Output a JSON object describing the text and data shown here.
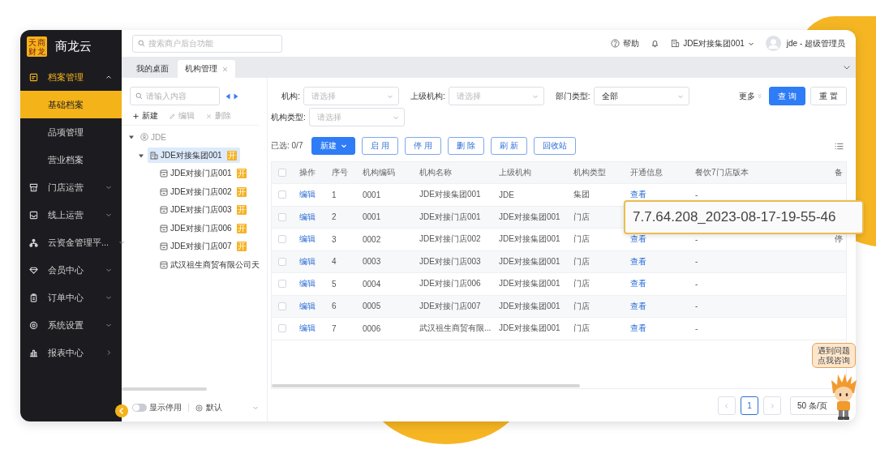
{
  "app": {
    "logo_lines": [
      "天商",
      "财龙"
    ],
    "brand": "商龙云"
  },
  "sidebar": {
    "items": [
      {
        "label": "档案管理",
        "kind": "accordion",
        "expanded": true,
        "active": true,
        "children": [
          {
            "label": "基础档案",
            "selected": true
          },
          {
            "label": "品项管理",
            "selected": false
          },
          {
            "label": "营业档案",
            "selected": false
          }
        ]
      },
      {
        "label": "门店运营",
        "kind": "accordion",
        "expanded": false,
        "active": false
      },
      {
        "label": "线上运营",
        "kind": "accordion",
        "expanded": false,
        "active": false
      },
      {
        "label": "云资金管理平...",
        "kind": "accordion",
        "expanded": false,
        "active": false
      },
      {
        "label": "会员中心",
        "kind": "accordion",
        "expanded": false,
        "active": false
      },
      {
        "label": "订单中心",
        "kind": "accordion",
        "expanded": false,
        "active": false
      },
      {
        "label": "系统设置",
        "kind": "accordion",
        "expanded": false,
        "active": false
      },
      {
        "label": "报表中心",
        "kind": "flyout",
        "active": false
      }
    ]
  },
  "header": {
    "search": {
      "placeholder": "搜索商户后台功能"
    },
    "help": "帮助",
    "organization": "JDE对接集团001",
    "user": "jde - 超级管理员"
  },
  "tabs": [
    {
      "label": "我的桌面",
      "selected": false,
      "closable": false
    },
    {
      "label": "机构管理",
      "selected": true,
      "closable": true
    }
  ],
  "tree_panel": {
    "search": {
      "placeholder": "请输入内容"
    },
    "actions": [
      {
        "label": "新建",
        "disabled": false
      },
      {
        "label": "编辑",
        "disabled": true
      },
      {
        "label": "删除",
        "disabled": true
      }
    ],
    "tree": [
      {
        "label": "JDE",
        "kind": "root",
        "expanded": true,
        "selected": false,
        "children": [
          {
            "label": "JDE对接集团001",
            "kind": "group",
            "expanded": true,
            "selected": true,
            "badge": "开",
            "children": [
              {
                "label": "JDE对接门店001",
                "kind": "store",
                "selected": false,
                "badge": "开"
              },
              {
                "label": "JDE对接门店002",
                "kind": "store",
                "selected": false,
                "badge": "开"
              },
              {
                "label": "JDE对接门店003",
                "kind": "store",
                "selected": false,
                "badge": "开"
              },
              {
                "label": "JDE对接门店006",
                "kind": "store",
                "selected": false,
                "badge": "开"
              },
              {
                "label": "JDE对接门店007",
                "kind": "store",
                "selected": false,
                "badge": "开"
              },
              {
                "label": "武汉祖生商贸有限公司天",
                "kind": "store",
                "selected": false
              }
            ]
          }
        ]
      }
    ],
    "footer": {
      "show_disabled": {
        "label": "显示停用",
        "on": false
      },
      "view": "默认"
    }
  },
  "filters": {
    "rows": [
      [
        {
          "label": "机构:",
          "placeholder": "请选择"
        },
        {
          "label": "上级机构:",
          "placeholder": "请选择"
        },
        {
          "label": "部门类型:",
          "value": "全部"
        }
      ],
      [
        {
          "label": "机构类型:",
          "placeholder": "请选择"
        }
      ]
    ],
    "more": "更多",
    "query": "查 询",
    "reset": "重 置"
  },
  "toolbar": {
    "selected_count": "已选: 0/7",
    "buttons": [
      {
        "label": "新建",
        "kind": "dropdown"
      },
      {
        "label": "启 用",
        "kind": "outline"
      },
      {
        "label": "停 用",
        "kind": "outline"
      },
      {
        "label": "删 除",
        "kind": "outline"
      },
      {
        "label": "刷 新",
        "kind": "outline"
      },
      {
        "label": "回收站",
        "kind": "outline"
      }
    ]
  },
  "table": {
    "select_all": {
      "checked": false
    },
    "columns": [
      {
        "label": "操作",
        "kind": "link"
      },
      {
        "label": "序号",
        "kind": "text"
      },
      {
        "label": "机构编码",
        "kind": "text"
      },
      {
        "label": "机构名称",
        "kind": "text"
      },
      {
        "label": "上级机构",
        "kind": "text"
      },
      {
        "label": "机构类型",
        "kind": "text"
      },
      {
        "label": "开通信息",
        "kind": "link"
      },
      {
        "label": "餐饮7门店版本",
        "kind": "text"
      },
      {
        "label": "备",
        "kind": "text"
      }
    ],
    "rows": [
      {
        "checked": false,
        "action": "编辑",
        "no": "1",
        "code": "0001",
        "name": "JDE对接集团001",
        "parent": "JDE",
        "type": "集团",
        "info": "查看",
        "version": "-"
      },
      {
        "checked": false,
        "action": "编辑",
        "no": "2",
        "code": "0001",
        "name": "JDE对接门店001",
        "parent": "JDE对接集团001",
        "type": "门店"
      },
      {
        "checked": false,
        "action": "编辑",
        "no": "3",
        "code": "0002",
        "name": "JDE对接门店002",
        "parent": "JDE对接集团001",
        "type": "门店",
        "info": "查看",
        "version": "-",
        "column_9": "停"
      },
      {
        "checked": false,
        "action": "编辑",
        "no": "4",
        "code": "0003",
        "name": "JDE对接门店003",
        "parent": "JDE对接集团001",
        "type": "门店",
        "info": "查看",
        "version": "-"
      },
      {
        "checked": false,
        "action": "编辑",
        "no": "5",
        "code": "0004",
        "name": "JDE对接门店006",
        "parent": "JDE对接集团001",
        "type": "门店",
        "info": "查看",
        "version": "-"
      },
      {
        "checked": false,
        "action": "编辑",
        "no": "6",
        "code": "0005",
        "name": "JDE对接门店007",
        "parent": "JDE对接集团001",
        "type": "门店",
        "info": "查看",
        "version": "-"
      },
      {
        "checked": false,
        "action": "编辑",
        "no": "7",
        "code": "0006",
        "name": "武汉祖生商贸有限...",
        "parent": "JDE对接集团001",
        "type": "门店",
        "info": "查看",
        "version": "-"
      }
    ]
  },
  "tooltip": {
    "text": "7.7.64.208_2023-08-17-19-55-46"
  },
  "pagination": {
    "prev": {
      "disabled": true
    },
    "pages": [
      {
        "label": "1",
        "selected": true
      }
    ],
    "next": {
      "disabled": true
    },
    "page_size": "50 条/页"
  },
  "help_widget": {
    "lines": [
      "遇到问题",
      "点我咨询"
    ]
  }
}
